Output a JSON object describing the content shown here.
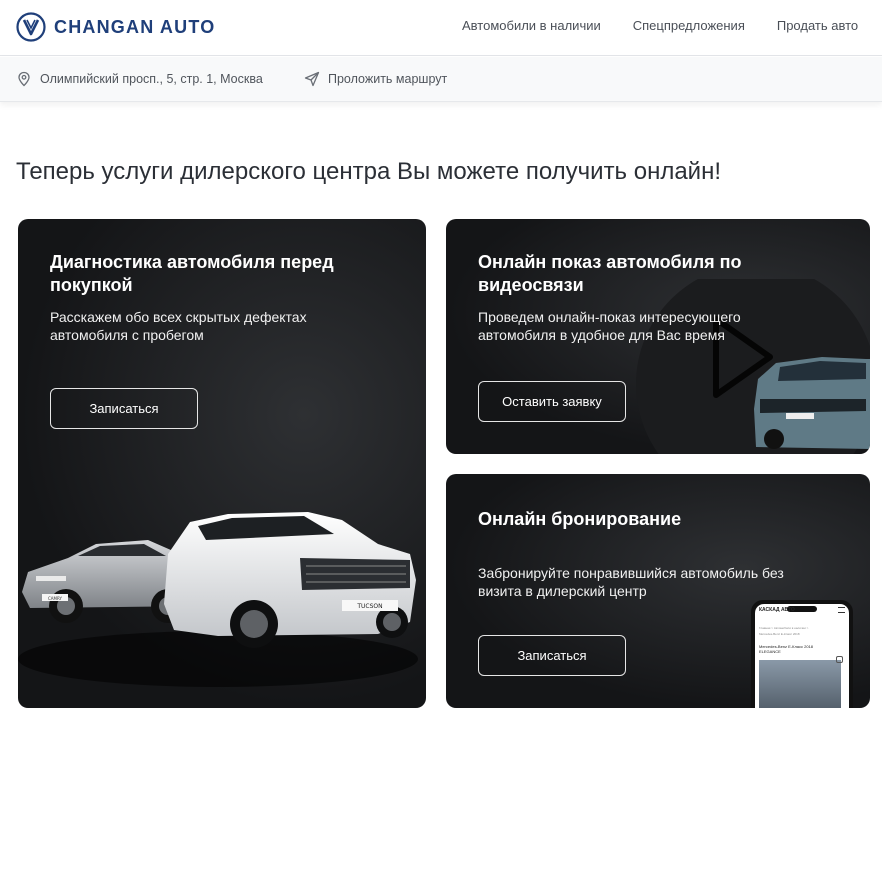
{
  "brand": {
    "name": "CHANGAN AUTO",
    "color": "#1f3f7a",
    "icon": "changan-emblem-icon"
  },
  "nav": {
    "items": [
      {
        "label": "Автомобили в наличии"
      },
      {
        "label": "Спецпредложения"
      },
      {
        "label": "Продать авто"
      }
    ]
  },
  "subbar": {
    "address": "Олимпийский просп., 5, стр. 1, Москва",
    "address_icon": "location-pin-icon",
    "route": "Проложить маршрут",
    "route_icon": "send-arrow-icon"
  },
  "main": {
    "title": "Теперь услуги дилерского центра Вы можете получить онлайн!",
    "cards": [
      {
        "title": "Диагностика автомобиля перед покупкой",
        "description": "Расскажем обо всех скрытых дефектах автомобиля с пробегом",
        "button": "Записаться",
        "plates": [
          "CAMRY",
          "TUCSON"
        ]
      },
      {
        "title": "Онлайн показ автомобиля по видеосвязи",
        "description": "Проведем онлайн-показ интересующего автомобиля в удобное для Вас время",
        "button": "Оставить заявку",
        "decor_icon": "play-icon"
      },
      {
        "title": "Онлайн бронирование",
        "description": "Забронируйте понравившийся автомобиль без визита в дилерский центр",
        "button": "Записаться",
        "phone": {
          "header": "КАСКАД АВТО",
          "line1": "Главная > Автомобили в наличии >",
          "line2": "Mercedes-Benz E-Класс 2018",
          "title": "Mercedes-Benz E-Класс 2018 ELEGANCE"
        }
      }
    ]
  },
  "colors": {
    "card_bg": "#141517",
    "text_dark": "#2b2f36",
    "subbar_bg": "#f8f9fa"
  }
}
